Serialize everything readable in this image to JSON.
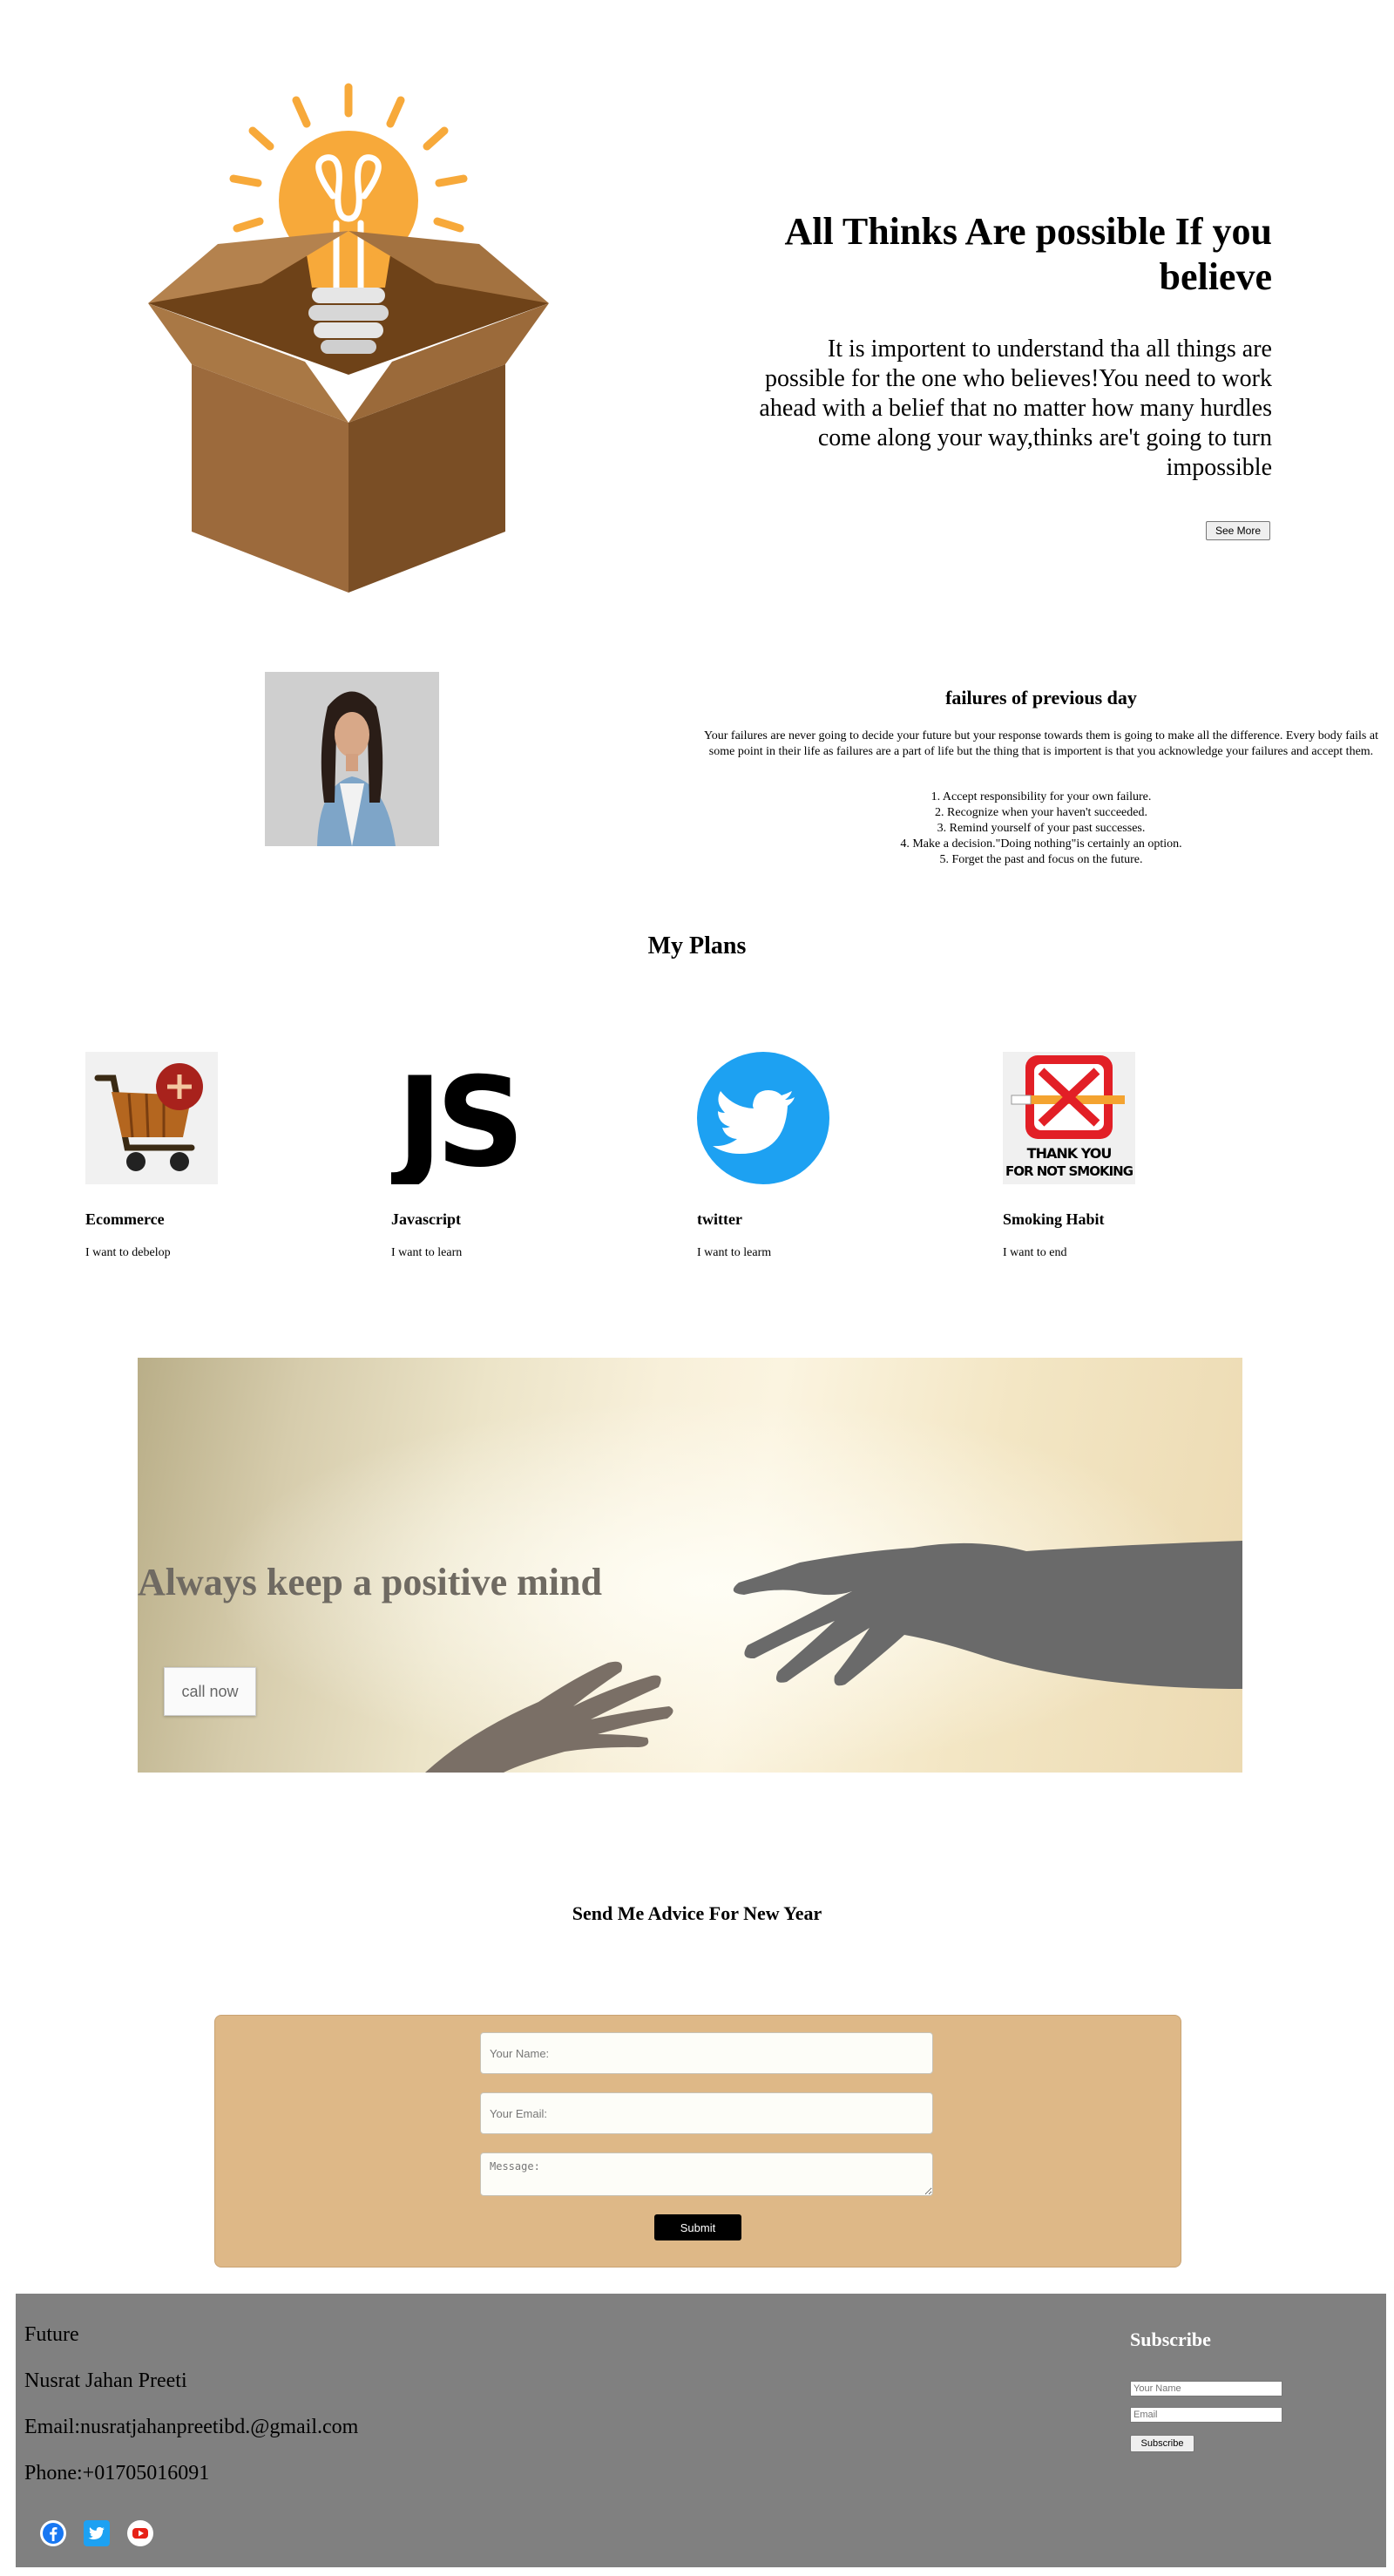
{
  "hero": {
    "title": "All Thinks Are possible If you believe",
    "text": "It is importent to understand tha all things are possible for the one who believes!You need to work ahead with a belief that no matter how many hurdles come along your way,thinks are't going to turn impossible",
    "see_more_label": "See More"
  },
  "failures": {
    "title": "failures of previous day",
    "text": "Your failures are never going to decide your future but your response towards them is going to make all the difference. Every body fails at some point in their life as failures are a part of life but the thing that is importent is that you acknowledge your failures and accept them.",
    "list": [
      "1. Accept responsibility for your own failure.",
      "2. Recognize when your haven't succeeded.",
      "3. Remind yourself of your past successes.",
      "4. Make a decision.\"Doing nothing\"is certainly an option.",
      "5. Forget the past and focus on the future."
    ]
  },
  "plans": {
    "title": "My Plans",
    "items": [
      {
        "title": "Ecommerce",
        "text": "I want to debelop",
        "icon": "shopping-cart-icon"
      },
      {
        "title": "Javascript",
        "text": "I want to learn",
        "icon": "js-logo-icon",
        "icon_text": "JS"
      },
      {
        "title": "twitter",
        "text": "I want to learm",
        "icon": "twitter-bird-icon"
      },
      {
        "title": "Smoking Habit",
        "text": "I want to end",
        "icon": "no-smoking-icon",
        "icon_text": "THANK YOU FOR NOT SMOKING"
      }
    ]
  },
  "banner": {
    "title": "Always keep a positive mind",
    "button_label": "call now"
  },
  "advice": {
    "title": "Send Me Advice For New Year",
    "name_placeholder": "Your Name:",
    "email_placeholder": "Your Email:",
    "message_placeholder": "Message:",
    "submit_label": "Submit"
  },
  "footer": {
    "brand": "Future",
    "name": "Nusrat Jahan Preeti",
    "email": "Email:nusratjahanpreetibd.@gmail.com",
    "phone": "Phone:+01705016091",
    "social": [
      "facebook-icon",
      "twitter-icon",
      "youtube-icon"
    ],
    "subscribe_title": "Subscribe",
    "sub_name_placeholder": "Your Name",
    "sub_email_placeholder": "Email",
    "subscribe_label": "Subscribe"
  },
  "colors": {
    "form_bg": "#deb887",
    "footer_bg": "#808080",
    "twitter_blue": "#1da1f2",
    "bulb": "#f7a93a",
    "box": "#9c6a3c"
  }
}
